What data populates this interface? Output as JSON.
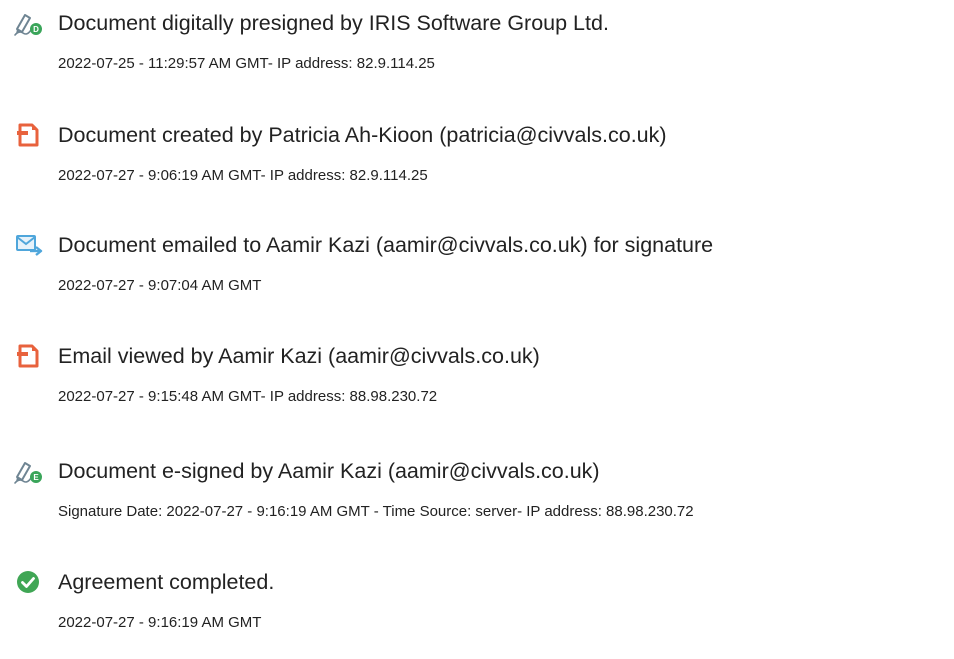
{
  "colors": {
    "text": "#222222",
    "signature_icon": "#6f8593",
    "signature_badge": "#3aa55a",
    "document_icon": "#e8623d",
    "email_icon": "#4fa6db",
    "completed_icon": "#40a655"
  },
  "events": [
    {
      "icon": "signature-pen-icon",
      "title": "Document digitally presigned by IRIS Software Group Ltd.",
      "details": "2022-07-25 - 11:29:57 AM GMT- IP address: 82.9.114.25"
    },
    {
      "icon": "document-created-icon",
      "title": "Document created by Patricia Ah-Kioon (patricia@civvals.co.uk)",
      "details": "2022-07-27 - 9:06:19 AM GMT- IP address: 82.9.114.25"
    },
    {
      "icon": "email-sent-icon",
      "title": "Document emailed to Aamir Kazi (aamir@civvals.co.uk) for signature",
      "details": "2022-07-27 - 9:07:04 AM GMT"
    },
    {
      "icon": "document-viewed-icon",
      "title": "Email viewed by Aamir Kazi (aamir@civvals.co.uk)",
      "details": "2022-07-27 - 9:15:48 AM GMT- IP address: 88.98.230.72"
    },
    {
      "icon": "signature-pen-icon",
      "title": "Document e-signed by Aamir Kazi (aamir@civvals.co.uk)",
      "details": "Signature Date: 2022-07-27 - 9:16:19 AM GMT - Time Source: server- IP address: 88.98.230.72"
    },
    {
      "icon": "check-circle-icon",
      "title": "Agreement completed.",
      "details": "2022-07-27 - 9:16:19 AM GMT"
    }
  ]
}
